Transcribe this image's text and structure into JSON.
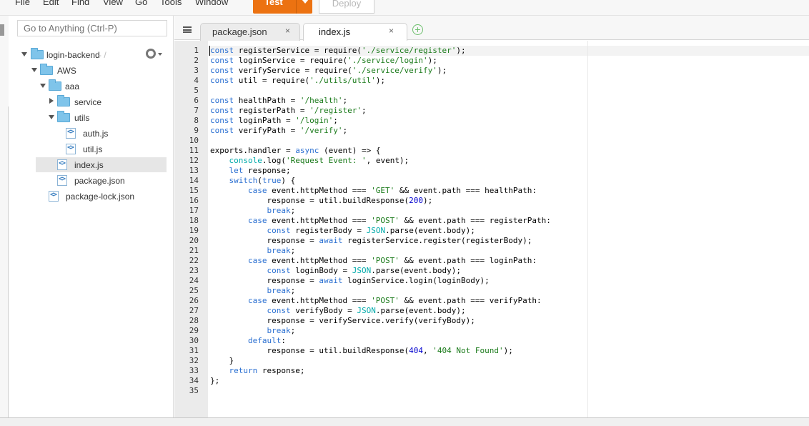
{
  "menubar": {
    "items": [
      "File",
      "Edit",
      "Find",
      "View",
      "Go",
      "Tools",
      "Window"
    ],
    "test_label": "Test",
    "deploy_label": "Deploy",
    "accent": "#ec7211"
  },
  "sidebar": {
    "goto_placeholder": "Go to Anything (Ctrl-P)",
    "tree": [
      {
        "label": "login-backend",
        "suffix": "- /",
        "type": "folder",
        "expanded": true
      },
      {
        "label": "AWS",
        "type": "folder",
        "expanded": true
      },
      {
        "label": "aaa",
        "type": "folder",
        "expanded": true
      },
      {
        "label": "service",
        "type": "folder",
        "expanded": false
      },
      {
        "label": "utils",
        "type": "folder",
        "expanded": true
      },
      {
        "label": "auth.js",
        "type": "file"
      },
      {
        "label": "util.js",
        "type": "file"
      },
      {
        "label": "index.js",
        "type": "file",
        "selected": true
      },
      {
        "label": "package.json",
        "type": "file"
      },
      {
        "label": "package-lock.json",
        "type": "file"
      }
    ]
  },
  "tabs": [
    {
      "label": "package.json",
      "close": "×",
      "active": false
    },
    {
      "label": "index.js",
      "close": "×",
      "active": true
    }
  ],
  "add_tab_symbol": "+",
  "editor": {
    "line_numbers": [
      "1",
      "2",
      "3",
      "4",
      "5",
      "6",
      "7",
      "8",
      "9",
      "10",
      "11",
      "12",
      "13",
      "14",
      "15",
      "16",
      "17",
      "18",
      "19",
      "20",
      "21",
      "22",
      "23",
      "24",
      "25",
      "26",
      "27",
      "28",
      "29",
      "30",
      "31",
      "32",
      "33",
      "34",
      "35"
    ],
    "lines": [
      "const registerService = require('./service/register');",
      "const loginService = require('./service/login');",
      "const verifyService = require('./service/verify');",
      "const util = require('./utils/util');",
      "",
      "const healthPath = '/health';",
      "const registerPath = '/register';",
      "const loginPath = '/login';",
      "const verifyPath = '/verify';",
      "",
      "exports.handler = async (event) => {",
      "    console.log('Request Event: ', event);",
      "    let response;",
      "    switch(true) {",
      "        case event.httpMethod === 'GET' && event.path === healthPath:",
      "            response = util.buildResponse(200);",
      "            break;",
      "        case event.httpMethod === 'POST' && event.path === registerPath:",
      "            const registerBody = JSON.parse(event.body);",
      "            response = await registerService.register(registerBody);",
      "            break;",
      "        case event.httpMethod === 'POST' && event.path === loginPath:",
      "            const loginBody = JSON.parse(event.body);",
      "            response = await loginService.login(loginBody);",
      "            break;",
      "        case event.httpMethod === 'POST' && event.path === verifyPath:",
      "            const verifyBody = JSON.parse(event.body);",
      "            response = verifyService.verify(verifyBody);",
      "            break;",
      "        default:",
      "            response = util.buildResponse(404, '404 Not Found');",
      "    }",
      "    return response;",
      "};",
      ""
    ]
  }
}
